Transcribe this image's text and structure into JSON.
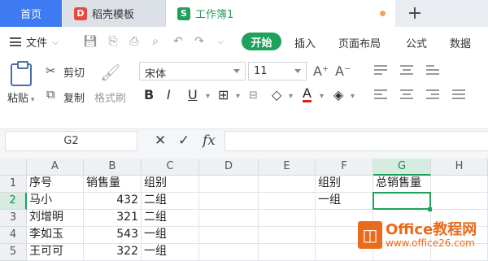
{
  "tabs": {
    "home": "首页",
    "doc": "稻壳模板",
    "workbook": "工作簿1",
    "add": "+"
  },
  "menu": {
    "file": "文件",
    "start": "开始",
    "insert": "插入",
    "layout": "页面布局",
    "formula": "公式",
    "data": "数据"
  },
  "ribbon": {
    "paste": "粘贴",
    "cut": "剪切",
    "copy": "复制",
    "format_painter": "格式刷",
    "font_name": "宋体",
    "font_size": "11"
  },
  "formula_bar": {
    "name_box": "G2",
    "fx": "fx",
    "value": ""
  },
  "grid": {
    "columns": [
      "A",
      "B",
      "C",
      "D",
      "E",
      "F",
      "G",
      "H"
    ],
    "rows": [
      "1",
      "2",
      "3",
      "4",
      "5"
    ],
    "selected_column": "G",
    "selected_row": "2",
    "cells": {
      "A1": "序号",
      "B1": "销售量",
      "C1": "组别",
      "F1": "组别",
      "G1": "总销售量",
      "A2": "马小",
      "B2": "432",
      "C2": "二组",
      "F2": "一组",
      "A3": "刘增明",
      "B3": "321",
      "C3": "二组",
      "A4": "李如玉",
      "B4": "543",
      "C4": "一组",
      "A5": "王可可",
      "B5": "322",
      "C5": "一组"
    }
  },
  "watermark": {
    "title": "Office教程网",
    "url": "www.office26.com"
  },
  "colors": {
    "accent": "#1fa15c",
    "tab_home": "#3e7af2",
    "watermark": "#e96b1c"
  }
}
